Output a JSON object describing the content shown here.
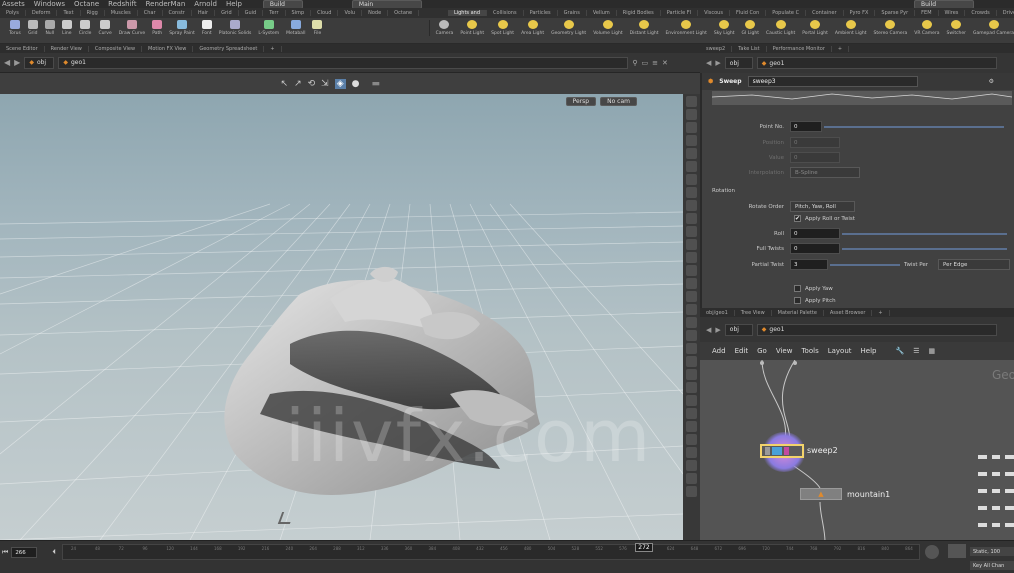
{
  "menubar": {
    "items": [
      "Assets",
      "Windows",
      "Octane",
      "Redshift",
      "RenderMan",
      "Arnold",
      "Help"
    ],
    "build_label": "Build",
    "main_label": "Main",
    "right_label": "Build"
  },
  "shelf_tabs": {
    "left": [
      "Polys",
      "Deform",
      "Text",
      "Rigg",
      "Muscles",
      "Char",
      "Constr",
      "Hair",
      "Grid",
      "Guid",
      "Terr",
      "Simp",
      "Cloud",
      "Volu",
      "Node",
      "Octane"
    ],
    "right": [
      "Lights and",
      "Collisions",
      "Particles",
      "Grains",
      "Vellum",
      "Rigid Bodies",
      "Particle Fl",
      "Viscous",
      "Fluid Con",
      "Populate C",
      "Container",
      "Pyro FX",
      "Sparse Pyr",
      "FEM",
      "Wires",
      "Crowds",
      "Drive Si"
    ]
  },
  "tools_left": [
    "Torus",
    "Grid",
    "Null",
    "Line",
    "Circle",
    "Curve",
    "Draw Curve",
    "Path",
    "Spray Paint",
    "Font",
    "Platonic Solids",
    "L-System",
    "Metaball",
    "File"
  ],
  "tools_right": [
    "Camera",
    "Point Light",
    "Spot Light",
    "Area Light",
    "Geometry Light",
    "Volume Light",
    "Distant Light",
    "Environment Light",
    "Sky Light",
    "GI Light",
    "Caustic Light",
    "Portal Light",
    "Ambient Light",
    "Stereo Camera",
    "VR Camera",
    "Switcher",
    "Gamepad Camera"
  ],
  "pane_tabs": [
    "Scene Editor",
    "Render View",
    "Composite View",
    "Motion FX View",
    "Geometry Spreadsheet"
  ],
  "viewport": {
    "path": "obj",
    "node": "geo1",
    "persp_label": "Persp",
    "cam_label": "No cam",
    "watermark": "iiivfx.com"
  },
  "right_tabs": [
    "sweep2",
    "Take List",
    "Performance Monitor"
  ],
  "params_path": {
    "obj": "obj",
    "node": "geo1"
  },
  "params": {
    "node_type": "Sweep",
    "node_name": "sweep3",
    "point_no_label": "Point No.",
    "point_no": "0",
    "position_label": "Position",
    "position": "0",
    "value_label": "Value",
    "value": "0",
    "interp_label": "Interpolation",
    "interp": "B-Spline",
    "section_label": "Rotation",
    "rotate_order_label": "Rotate Order",
    "rotate_order": "Pitch, Yaw, Roll",
    "apply_roll_label": "Apply Roll or Twist",
    "roll_label": "Roll",
    "roll": "0",
    "full_twists_label": "Full Twists",
    "full_twists": "0",
    "partial_twist_label": "Partial Twist",
    "partial_twist": "3",
    "twist_per_label": "Twist Per",
    "twist_per": "Per Edge",
    "apply_yaw_label": "Apply Yaw",
    "apply_pitch_label": "Apply Pitch"
  },
  "net_tabs": [
    "obj/geo1",
    "Tree View",
    "Material Palette",
    "Asset Browser"
  ],
  "net_path": {
    "obj": "obj",
    "node": "geo1"
  },
  "net_menu": [
    "Add",
    "Edit",
    "Go",
    "View",
    "Tools",
    "Layout",
    "Help"
  ],
  "network": {
    "node1": "sweep2",
    "node2": "mountain1",
    "corner_label": "Geo"
  },
  "timeline": {
    "frame": "266",
    "current": "272",
    "ticks": [
      "24",
      "48",
      "72",
      "96",
      "120",
      "144",
      "168",
      "192",
      "216",
      "240",
      "264",
      "288",
      "312",
      "336",
      "360",
      "384",
      "408",
      "432",
      "456",
      "480",
      "504",
      "528",
      "552",
      "576",
      "600",
      "624",
      "648",
      "672",
      "696",
      "720",
      "744",
      "768",
      "792",
      "816",
      "840",
      "864"
    ],
    "right_label_1": "Static, 100",
    "right_label_2": "Key All Chan"
  },
  "colors": {
    "accent": "#e08a2c",
    "selected_node": "#f2d36b",
    "timeline_bar": "#2a2a2a"
  }
}
